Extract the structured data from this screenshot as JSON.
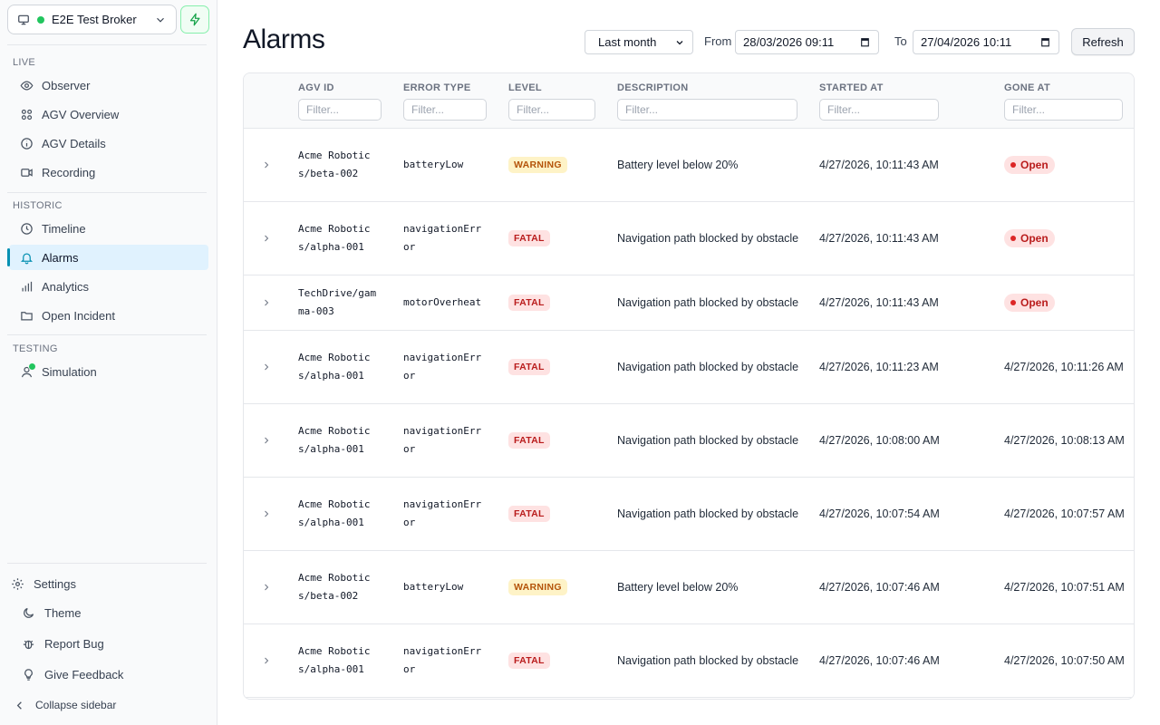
{
  "sidebar": {
    "broker_name": "E2E Test Broker",
    "sections": {
      "live": "LIVE",
      "historic": "HISTORIC",
      "testing": "TESTING"
    },
    "items": [
      {
        "label": "Observer",
        "icon": "eye-icon"
      },
      {
        "label": "AGV Overview",
        "icon": "grid-icon"
      },
      {
        "label": "AGV Details",
        "icon": "info-icon"
      },
      {
        "label": "Recording",
        "icon": "video-icon"
      },
      {
        "label": "Timeline",
        "icon": "clock-icon"
      },
      {
        "label": "Alarms",
        "icon": "bell-icon",
        "active": true
      },
      {
        "label": "Analytics",
        "icon": "bar-chart-icon"
      },
      {
        "label": "Open Incident",
        "icon": "folder-icon"
      },
      {
        "label": "Simulation",
        "icon": "user-icon"
      }
    ],
    "bottom": {
      "settings": "Settings",
      "theme": "Theme",
      "report_bug": "Report Bug",
      "give_feedback": "Give Feedback",
      "collapse": "Collapse sidebar"
    }
  },
  "header": {
    "title": "Alarms",
    "range": "Last month",
    "from_label": "From",
    "from_value": "28/03/2026 09:11",
    "to_label": "To",
    "to_value": "27/04/2026 10:11",
    "refresh": "Refresh"
  },
  "table": {
    "columns": [
      "AGV ID",
      "ERROR TYPE",
      "LEVEL",
      "DESCRIPTION",
      "STARTED AT",
      "GONE AT"
    ],
    "filter_placeholder": "Filter...",
    "rows": [
      {
        "agv_id": "Acme Robotics/beta-002",
        "error_type": "batteryLow",
        "level": "WARNING",
        "description": "Battery level below 20%",
        "started_at": "4/27/2026, 10:11:43 AM",
        "gone_at": "Open"
      },
      {
        "agv_id": "Acme Robotics/alpha-001",
        "error_type": "navigationError",
        "level": "FATAL",
        "description": "Navigation path blocked by obstacle",
        "started_at": "4/27/2026, 10:11:43 AM",
        "gone_at": "Open"
      },
      {
        "agv_id": "TechDrive/gamma-003",
        "error_type": "motorOverheat",
        "level": "FATAL",
        "description": "Navigation path blocked by obstacle",
        "started_at": "4/27/2026, 10:11:43 AM",
        "gone_at": "Open"
      },
      {
        "agv_id": "Acme Robotics/alpha-001",
        "error_type": "navigationError",
        "level": "FATAL",
        "description": "Navigation path blocked by obstacle",
        "started_at": "4/27/2026, 10:11:23 AM",
        "gone_at": "4/27/2026, 10:11:26 AM"
      },
      {
        "agv_id": "Acme Robotics/alpha-001",
        "error_type": "navigationError",
        "level": "FATAL",
        "description": "Navigation path blocked by obstacle",
        "started_at": "4/27/2026, 10:08:00 AM",
        "gone_at": "4/27/2026, 10:08:13 AM"
      },
      {
        "agv_id": "Acme Robotics/alpha-001",
        "error_type": "navigationError",
        "level": "FATAL",
        "description": "Navigation path blocked by obstacle",
        "started_at": "4/27/2026, 10:07:54 AM",
        "gone_at": "4/27/2026, 10:07:57 AM"
      },
      {
        "agv_id": "Acme Robotics/beta-002",
        "error_type": "batteryLow",
        "level": "WARNING",
        "description": "Battery level below 20%",
        "started_at": "4/27/2026, 10:07:46 AM",
        "gone_at": "4/27/2026, 10:07:51 AM"
      },
      {
        "agv_id": "Acme Robotics/alpha-001",
        "error_type": "navigationError",
        "level": "FATAL",
        "description": "Navigation path blocked by obstacle",
        "started_at": "4/27/2026, 10:07:46 AM",
        "gone_at": "4/27/2026, 10:07:50 AM"
      }
    ]
  }
}
